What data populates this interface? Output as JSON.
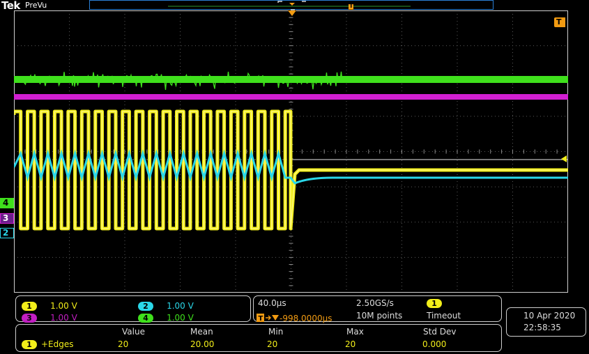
{
  "header": {
    "brand": "Tek",
    "mode": "PreVu"
  },
  "markers": {
    "trigger_pos": "T",
    "trigger_top_right": "T",
    "ch4": "4",
    "ch3": "3",
    "ch2": "2"
  },
  "colors": {
    "ch1": "#f2ee1a",
    "ch2": "#2ad7e8",
    "ch3": "#d21fd2",
    "ch4": "#3fe01c",
    "trigger": "#f29b12",
    "grid": "#5a5a5a",
    "frame": "#cfcfcf"
  },
  "channels": [
    {
      "num": "1",
      "scale": "1.00 V"
    },
    {
      "num": "2",
      "scale": "1.00 V"
    },
    {
      "num": "3",
      "scale": "1.00 V"
    },
    {
      "num": "4",
      "scale": "1.00 V"
    }
  ],
  "horizontal": {
    "scale": "40.0µs",
    "position": "-998.0000µs",
    "sample_rate": "2.50GS/s",
    "record_length": "10M points",
    "trigger_source": "1",
    "trigger_mode": "Timeout"
  },
  "datetime": {
    "date": "10 Apr 2020",
    "time": "22:58:35"
  },
  "measurement": {
    "headers": [
      "Value",
      "Mean",
      "Min",
      "Max",
      "Std Dev"
    ],
    "source": "1",
    "name": "+Edges",
    "values": [
      "20",
      "20.00",
      "20",
      "20",
      "0.000"
    ]
  }
}
